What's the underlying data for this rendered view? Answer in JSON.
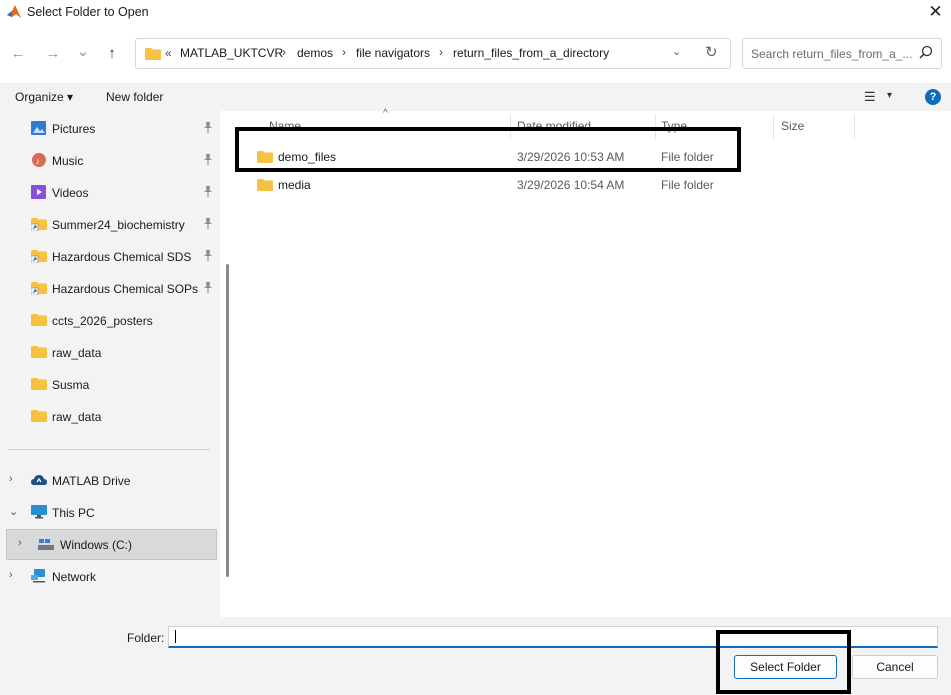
{
  "window": {
    "title": "Select Folder to Open",
    "close_glyph": "✕"
  },
  "nav": {
    "back_glyph": "←",
    "forward_glyph": "→",
    "recent_glyph": "⌄",
    "up_glyph": "↑"
  },
  "address": {
    "overflow": "«",
    "crumbs": [
      "MATLAB_UKTCVR",
      "demos",
      "file navigators",
      "return_files_from_a_directory"
    ],
    "separator": "›",
    "dropdown_glyph": "⌄",
    "refresh_glyph": "↻"
  },
  "search": {
    "placeholder": "Search return_files_from_a_...",
    "icon": "search-icon"
  },
  "toolbar": {
    "organize": "Organize ▾",
    "new_folder": "New folder",
    "view_glyph": "☰",
    "view_dd": "▾",
    "help": "?"
  },
  "sidebar": {
    "quick_access": [
      {
        "label": "Pictures",
        "icon": "pictures-icon",
        "pinned": true
      },
      {
        "label": "Music",
        "icon": "music-icon",
        "pinned": true
      },
      {
        "label": "Videos",
        "icon": "videos-icon",
        "pinned": true
      },
      {
        "label": "Summer24_biochemistry",
        "icon": "folder-shortcut-icon",
        "pinned": true
      },
      {
        "label": "Hazardous Chemical SDS",
        "icon": "folder-shortcut-icon",
        "pinned": true
      },
      {
        "label": "Hazardous Chemical SOPs",
        "icon": "folder-shortcut-icon",
        "pinned": true
      },
      {
        "label": "ccts_2026_posters",
        "icon": "folder-icon",
        "pinned": false
      },
      {
        "label": "raw_data",
        "icon": "folder-icon",
        "pinned": false
      },
      {
        "label": "Susma",
        "icon": "folder-icon",
        "pinned": false
      },
      {
        "label": "raw_data",
        "icon": "folder-icon",
        "pinned": false
      }
    ],
    "pin_glyph": "📌",
    "tree": [
      {
        "label": "MATLAB Drive",
        "icon": "cloud-icon",
        "chevron": "›"
      },
      {
        "label": "This PC",
        "icon": "pc-icon",
        "chevron": "⌄"
      },
      {
        "label": "Windows (C:)",
        "icon": "drive-icon",
        "chevron": "›",
        "selected": true
      },
      {
        "label": "Network",
        "icon": "network-icon",
        "chevron": "›"
      }
    ]
  },
  "columns": {
    "name": "Name",
    "date": "Date modified",
    "type": "Type",
    "size": "Size",
    "sort_glyph": "^"
  },
  "files": [
    {
      "name": "demo_files",
      "date": "3/29/2026 10:53 AM",
      "type": "File folder"
    },
    {
      "name": "media",
      "date": "3/29/2026 10:54 AM",
      "type": "File folder"
    }
  ],
  "footer": {
    "folder_label": "Folder:",
    "folder_value": "",
    "select_button": "Select Folder",
    "cancel_button": "Cancel"
  },
  "colors": {
    "accent": "#0f6cbd",
    "folder": "#f5c242",
    "sidebar_bg": "#f3f3f3",
    "selection_bg": "#d9d9d9"
  }
}
